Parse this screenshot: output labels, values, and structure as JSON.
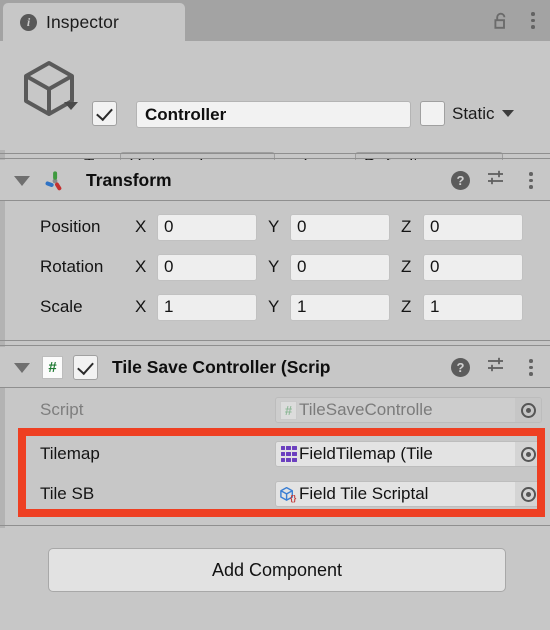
{
  "window": {
    "tab_label": "Inspector",
    "tab_icon": "info-icon",
    "lock_icon": "unlocked-padlock-icon",
    "menu_icon": "kebab-menu-icon"
  },
  "gameobject": {
    "icon": "cube-icon",
    "enabled": true,
    "name": "Controller",
    "static_label": "Static",
    "static_checked": false,
    "tag_label": "Tag",
    "tag_value": "Untagged",
    "layer_label": "Layer",
    "layer_value": "Default"
  },
  "components": [
    {
      "title": "Transform",
      "icon": "transform-gizmo-icon",
      "expanded": true,
      "has_toggle": false,
      "help_icon": "help-icon",
      "preset_icon": "preset-sliders-icon",
      "menu_icon": "kebab-menu-icon",
      "rows": [
        {
          "label": "Position",
          "axes": [
            {
              "axis": "X",
              "value": "0"
            },
            {
              "axis": "Y",
              "value": "0"
            },
            {
              "axis": "Z",
              "value": "0"
            }
          ]
        },
        {
          "label": "Rotation",
          "axes": [
            {
              "axis": "X",
              "value": "0"
            },
            {
              "axis": "Y",
              "value": "0"
            },
            {
              "axis": "Z",
              "value": "0"
            }
          ]
        },
        {
          "label": "Scale",
          "axes": [
            {
              "axis": "X",
              "value": "1"
            },
            {
              "axis": "Y",
              "value": "1"
            },
            {
              "axis": "Z",
              "value": "1"
            }
          ]
        }
      ]
    },
    {
      "title": "Tile Save Controller (Scrip",
      "icon": "csharp-script-icon",
      "expanded": true,
      "has_toggle": true,
      "enabled": true,
      "help_icon": "help-icon",
      "preset_icon": "preset-sliders-icon",
      "menu_icon": "kebab-menu-icon",
      "fields": [
        {
          "label": "Script",
          "value": "TileSaveControlle",
          "icon": "csharp-script-icon",
          "disabled": true,
          "picker_icon": "object-picker-icon"
        },
        {
          "label": "Tilemap",
          "value": "FieldTilemap (Tile",
          "icon": "tilemap-grid-icon",
          "disabled": false,
          "picker_icon": "object-picker-icon"
        },
        {
          "label": "Tile SB",
          "value": "Field Tile Scriptal",
          "icon": "scriptable-object-icon",
          "disabled": false,
          "picker_icon": "object-picker-icon"
        }
      ]
    }
  ],
  "highlight": {
    "color": "#ee3f22",
    "name": "red-annotation-box"
  },
  "footer": {
    "add_component_label": "Add Component"
  },
  "colors": {
    "panel_bg": "#c7c7c7",
    "tabbar_bg": "#a3a3a3",
    "field_bg": "#eeeeee",
    "accent_red": "#ee3f22",
    "tilemap_purple": "#6b3fbf",
    "script_green": "#1f7a33",
    "so_blue": "#3b7fd4"
  }
}
